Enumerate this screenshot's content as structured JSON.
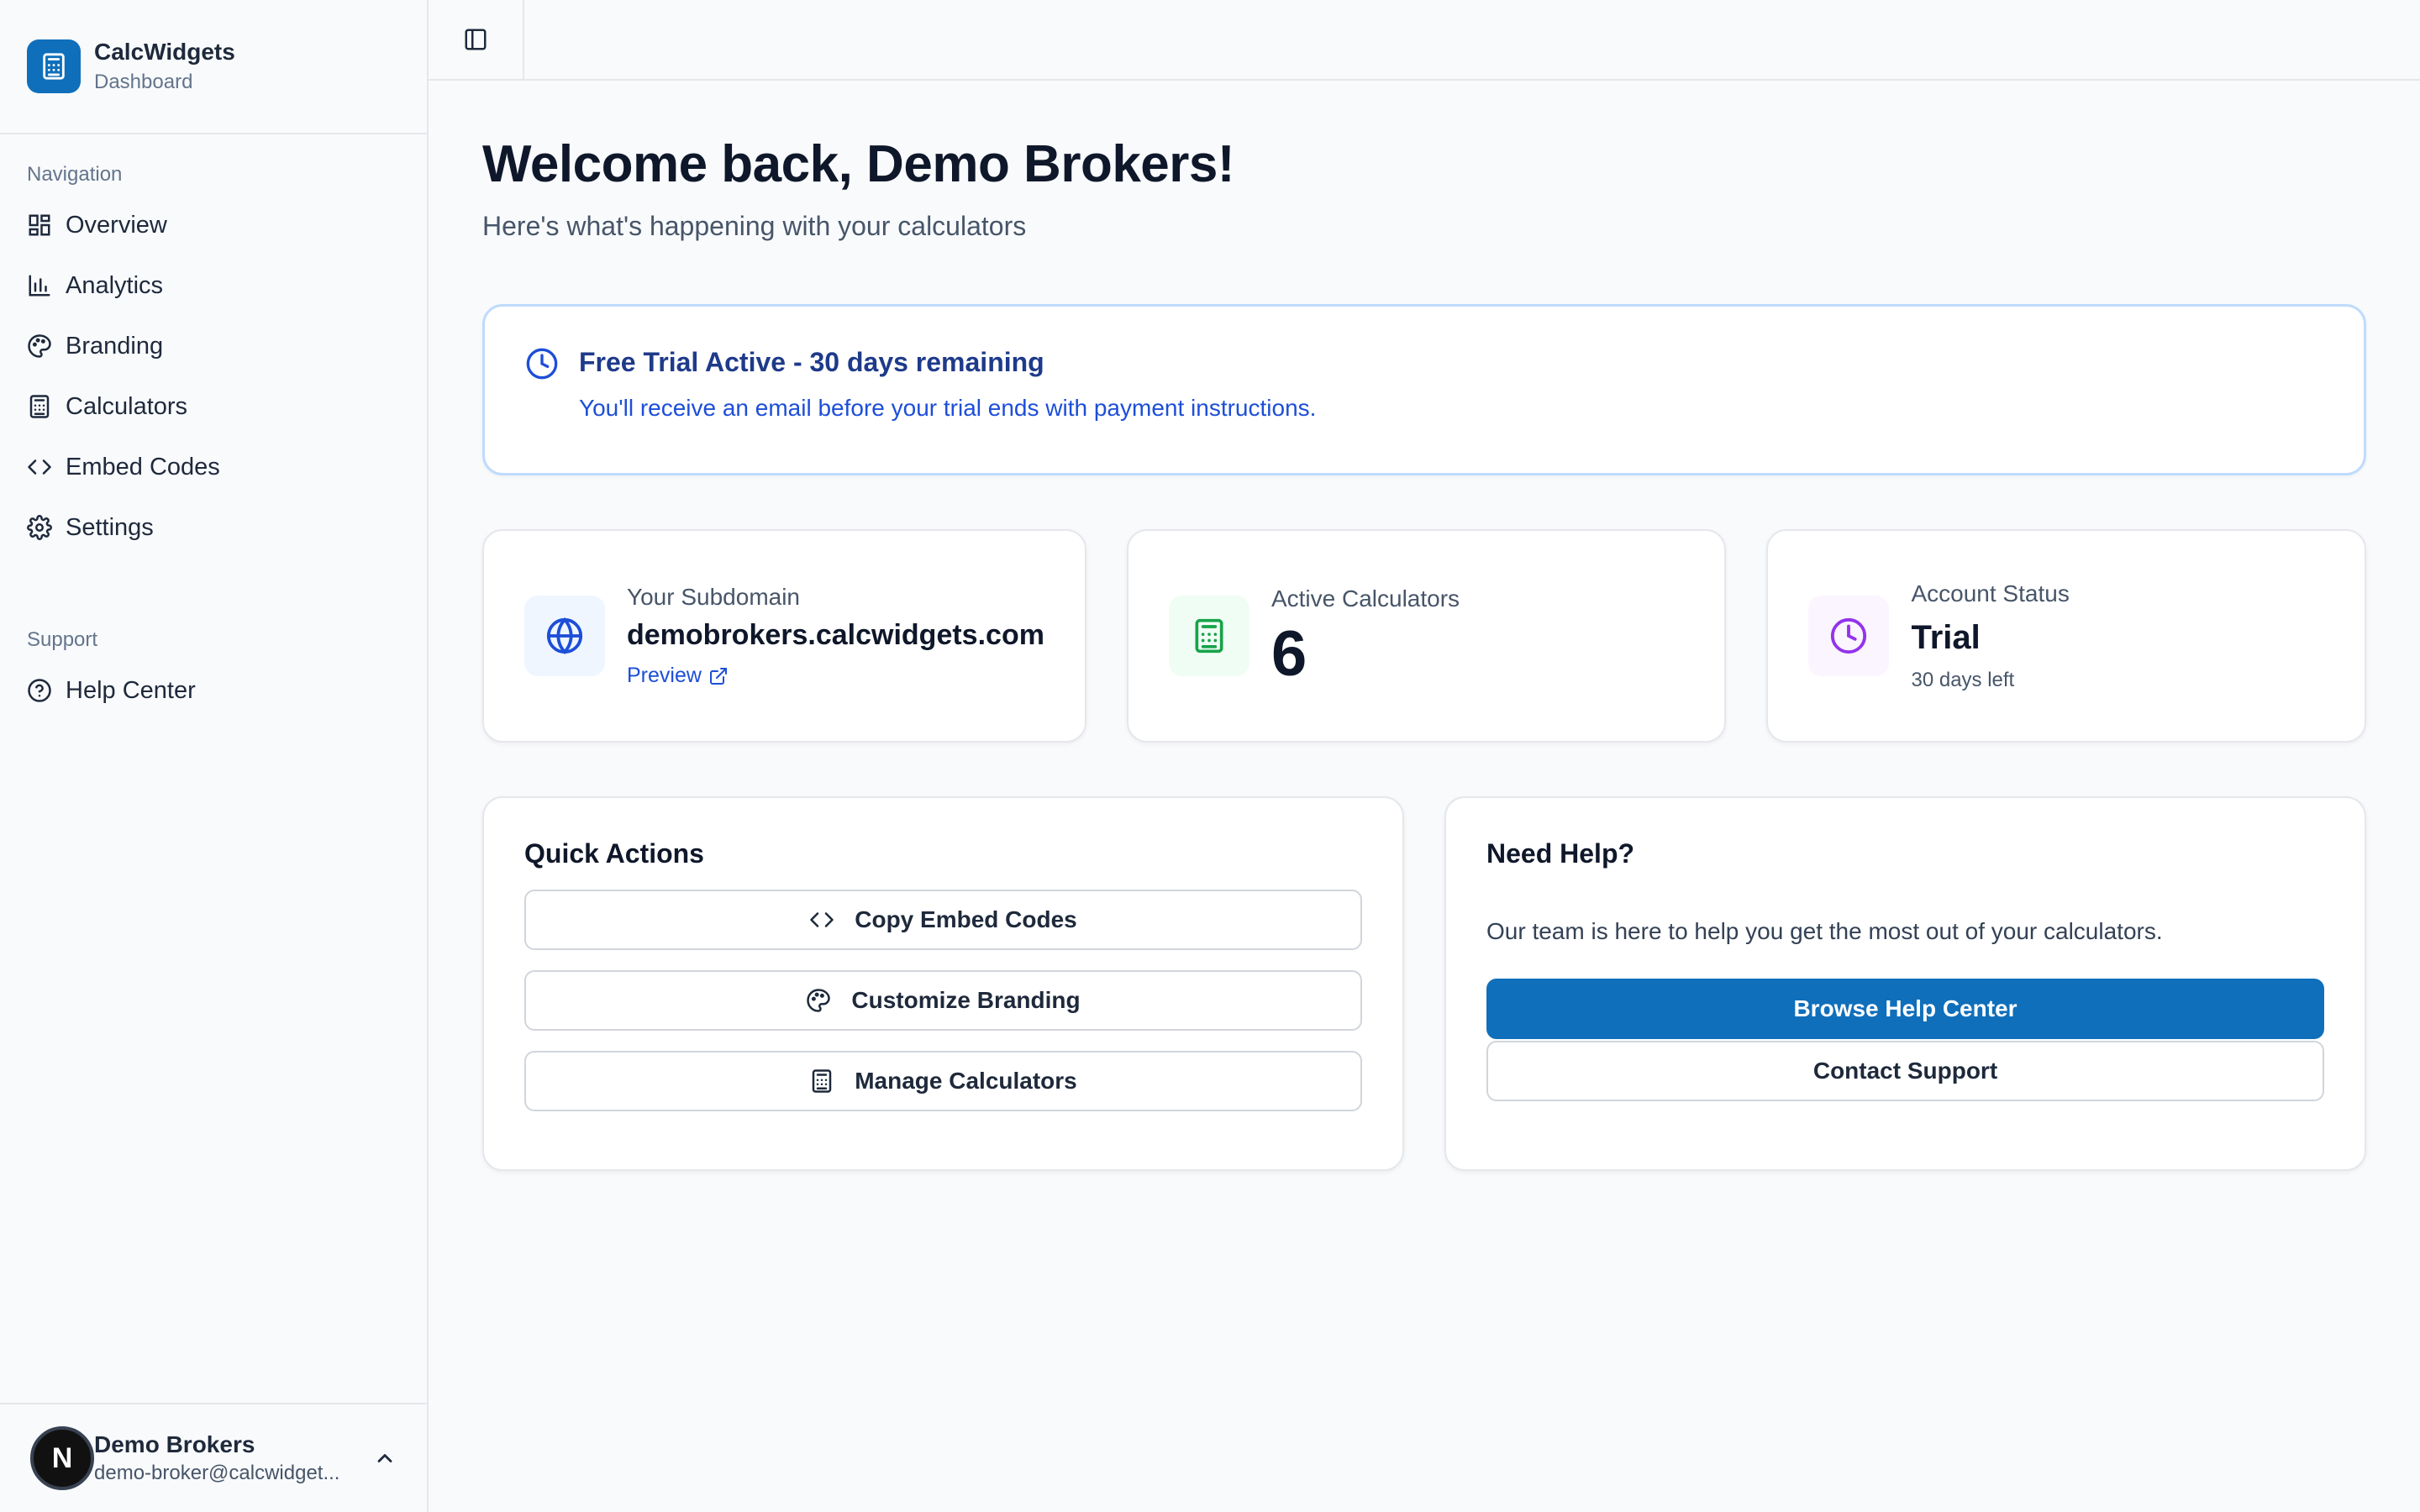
{
  "brand": {
    "title": "CalcWidgets",
    "subtitle": "Dashboard"
  },
  "sidebar": {
    "navigation_label": "Navigation",
    "nav_items": [
      {
        "label": "Overview",
        "icon": "grid-icon"
      },
      {
        "label": "Analytics",
        "icon": "bar-chart-icon"
      },
      {
        "label": "Branding",
        "icon": "palette-icon"
      },
      {
        "label": "Calculators",
        "icon": "calculator-icon"
      },
      {
        "label": "Embed Codes",
        "icon": "code-icon"
      },
      {
        "label": "Settings",
        "icon": "gear-icon"
      }
    ],
    "support_label": "Support",
    "support_items": [
      {
        "label": "Help Center",
        "icon": "help-circle-icon"
      }
    ]
  },
  "user": {
    "initial": "N",
    "name": "Demo Brokers",
    "email": "demo-broker@calcwidget..."
  },
  "header": {
    "title": "Welcome back, Demo Brokers!",
    "subtitle": "Here's what's happening with your calculators"
  },
  "trial": {
    "title": "Free Trial Active - 30 days remaining",
    "text": "You'll receive an email before your trial ends with payment instructions."
  },
  "stats": {
    "subdomain": {
      "label": "Your Subdomain",
      "value": "demobrokers.calcwidgets.com",
      "link": "Preview"
    },
    "calculators": {
      "label": "Active Calculators",
      "value": "6"
    },
    "account": {
      "label": "Account Status",
      "value": "Trial",
      "note": "30 days left"
    }
  },
  "quick_actions": {
    "title": "Quick Actions",
    "buttons": [
      "Copy Embed Codes",
      "Customize Branding",
      "Manage Calculators"
    ]
  },
  "help": {
    "title": "Need Help?",
    "text": "Our team is here to help you get the most out of your calculators.",
    "primary": "Browse Help Center",
    "secondary": "Contact Support"
  },
  "colors": {
    "accent": "#0f6fbb",
    "trial_border": "#bfdbfe",
    "globe_bg": "#eff6ff",
    "calc_bg": "#f0fdf4",
    "clock_bg": "#faf5ff"
  }
}
